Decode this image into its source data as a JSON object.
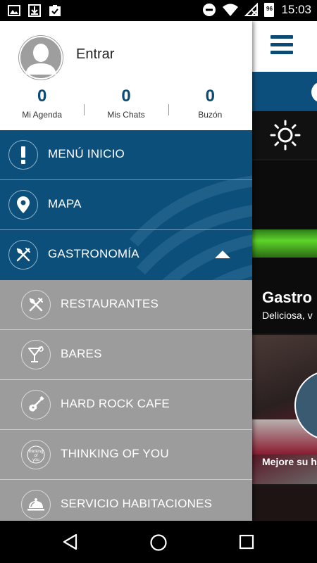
{
  "status_bar": {
    "time": "15:03",
    "battery_level": "96",
    "left_icons": [
      "image-icon",
      "download-icon",
      "clipboard-check-icon"
    ],
    "right_icons": [
      "do-not-disturb-icon",
      "wifi-icon",
      "no-signal-icon",
      "battery-icon"
    ]
  },
  "drawer": {
    "profile": {
      "login_label": "Entrar"
    },
    "stats": [
      {
        "value": "0",
        "label": "Mi Agenda"
      },
      {
        "value": "0",
        "label": "Mis Chats"
      },
      {
        "value": "0",
        "label": "Buzón"
      }
    ],
    "menu": [
      {
        "label": "MENÚ INICIO",
        "icon": "exclamation-icon"
      },
      {
        "label": "MAPA",
        "icon": "map-pin-icon"
      },
      {
        "label": "GASTRONOMÍA",
        "icon": "cutlery-icon",
        "expanded": true
      }
    ],
    "submenu": [
      {
        "label": "RESTAURANTES",
        "icon": "cutlery-icon"
      },
      {
        "label": "BARES",
        "icon": "cocktail-icon"
      },
      {
        "label": "HARD ROCK CAFE",
        "icon": "guitar-icon"
      },
      {
        "label": "THINKING OF YOU",
        "icon": "thinking-of-you-icon",
        "icon_text": [
          "thinking",
          "of",
          "you"
        ]
      },
      {
        "label": "SERVICIO HABITACIONES",
        "icon": "room-service-icon"
      }
    ]
  },
  "background_app": {
    "card1_title": "Gastro",
    "card1_subtitle": "Deliciosa, v",
    "card2_title": "Mejore su h"
  },
  "colors": {
    "primary_blue": "#0c4f7b",
    "submenu_gray": "#9c9c9c",
    "accent_navy": "#0d4a73"
  }
}
